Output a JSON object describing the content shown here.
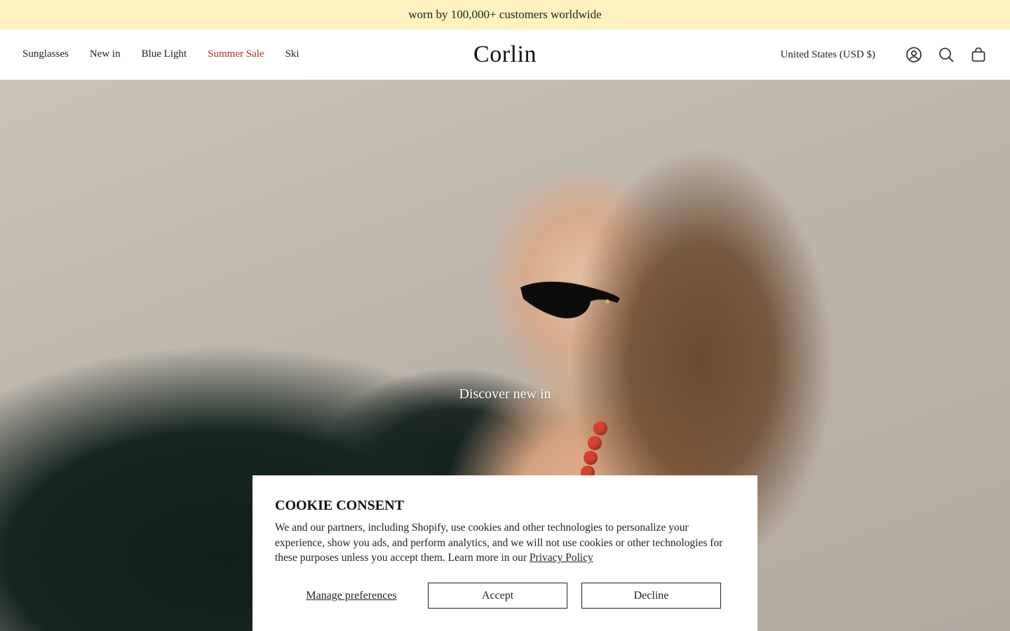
{
  "announcement": {
    "text": "worn by 100,000+ customers worldwide"
  },
  "header": {
    "logo": "Corlin",
    "nav": [
      {
        "label": "Sunglasses"
      },
      {
        "label": "New in"
      },
      {
        "label": "Blue Light"
      },
      {
        "label": "Summer Sale",
        "color": "#a7312b"
      },
      {
        "label": "Ski"
      }
    ],
    "currency": "United States (USD $)",
    "icons": [
      "account-icon",
      "search-icon",
      "cart-icon"
    ]
  },
  "hero": {
    "cta": "Discover new in"
  },
  "cookie": {
    "title": "COOKIE CONSENT",
    "body": "We and our partners, including Shopify, use cookies and other technologies to personalize your experience, show you ads, and perform analytics, and we will not use cookies or other technologies for these purposes unless you accept them. Learn more in our ",
    "privacy_link": "Privacy Policy",
    "manage_label": "Manage preferences",
    "accept_label": "Accept",
    "decline_label": "Decline"
  },
  "colors": {
    "announcement_bg": "#fdf2c0",
    "sale": "#a7312b"
  }
}
